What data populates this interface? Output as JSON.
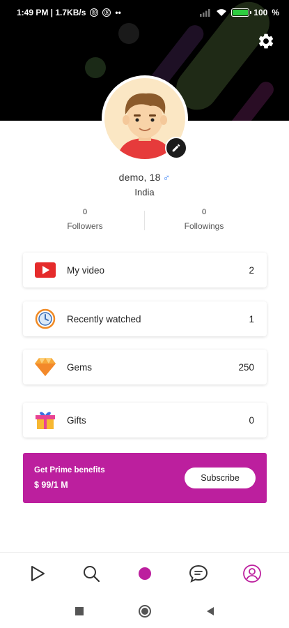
{
  "status_bar": {
    "time_info": "1:49 PM | 1.7KB/s",
    "battery": "100"
  },
  "colors": {
    "accent": "#bc1f9e",
    "header_bg": "#000000",
    "gender_male": "#3b82f6"
  },
  "profile": {
    "name_age": "demo, 18",
    "gender_symbol": "♂",
    "country": "India"
  },
  "stats": {
    "followers_count": "0",
    "followers_label": "Followers",
    "followings_count": "0",
    "followings_label": "Followings"
  },
  "menu": [
    {
      "label": "My video",
      "count": "2",
      "icon": "play-video-icon"
    },
    {
      "label": "Recently watched",
      "count": "1",
      "icon": "history-clock-icon"
    },
    {
      "label": "Gems",
      "count": "250",
      "icon": "gem-icon"
    },
    {
      "label": "Gifts",
      "count": "0",
      "icon": "gift-icon"
    }
  ],
  "prime": {
    "title": "Get Prime benefits",
    "price": "$ 99/1 M",
    "button_label": "Subscribe"
  },
  "bottom_nav": [
    "play-icon",
    "search-icon",
    "home-dot-icon",
    "chat-icon",
    "profile-icon"
  ],
  "system_nav": [
    "recents-square-icon",
    "home-circle-icon",
    "back-triangle-icon"
  ]
}
